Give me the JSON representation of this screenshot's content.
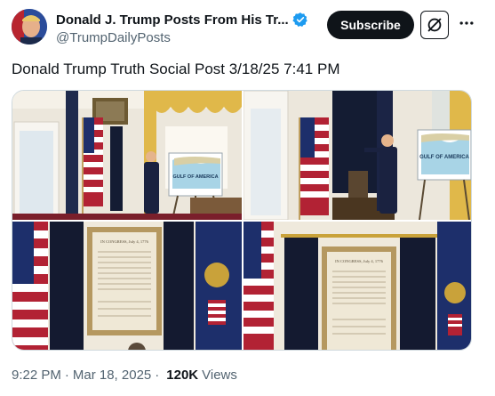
{
  "author": {
    "display_name": "Donald J. Trump Posts From His Tr...",
    "handle": "@TrumpDailyPosts",
    "verified_icon": "verified-badge-icon",
    "avatar_icon": "avatar-portrait"
  },
  "actions": {
    "subscribe_label": "Subscribe",
    "grok_icon": "grok-icon",
    "more_icon": "more-options-icon"
  },
  "post": {
    "text": "Donald Trump Truth Social Post 3/18/25 7:41 PM"
  },
  "media": {
    "images": [
      {
        "label": "oval-office-gulf-of-america-map-1",
        "map_text": "GULF OF AMERICA"
      },
      {
        "label": "oval-office-gulf-of-america-map-2",
        "map_text": "GULF OF AMERICA"
      },
      {
        "label": "declaration-framed-document-1",
        "doc_title": "IN CONGRESS, July 4, 1776"
      },
      {
        "label": "declaration-framed-document-2",
        "doc_title": "IN CONGRESS, July 4, 1776"
      }
    ]
  },
  "footer": {
    "time": "9:22 PM",
    "separator": "·",
    "date": "Mar 18, 2025",
    "separator2": "·",
    "views_count": "120K",
    "views_label": "Views"
  },
  "colors": {
    "text_primary": "#0f1419",
    "text_secondary": "#536471",
    "verified_blue": "#1d9bf0",
    "border": "#cfd9de"
  }
}
